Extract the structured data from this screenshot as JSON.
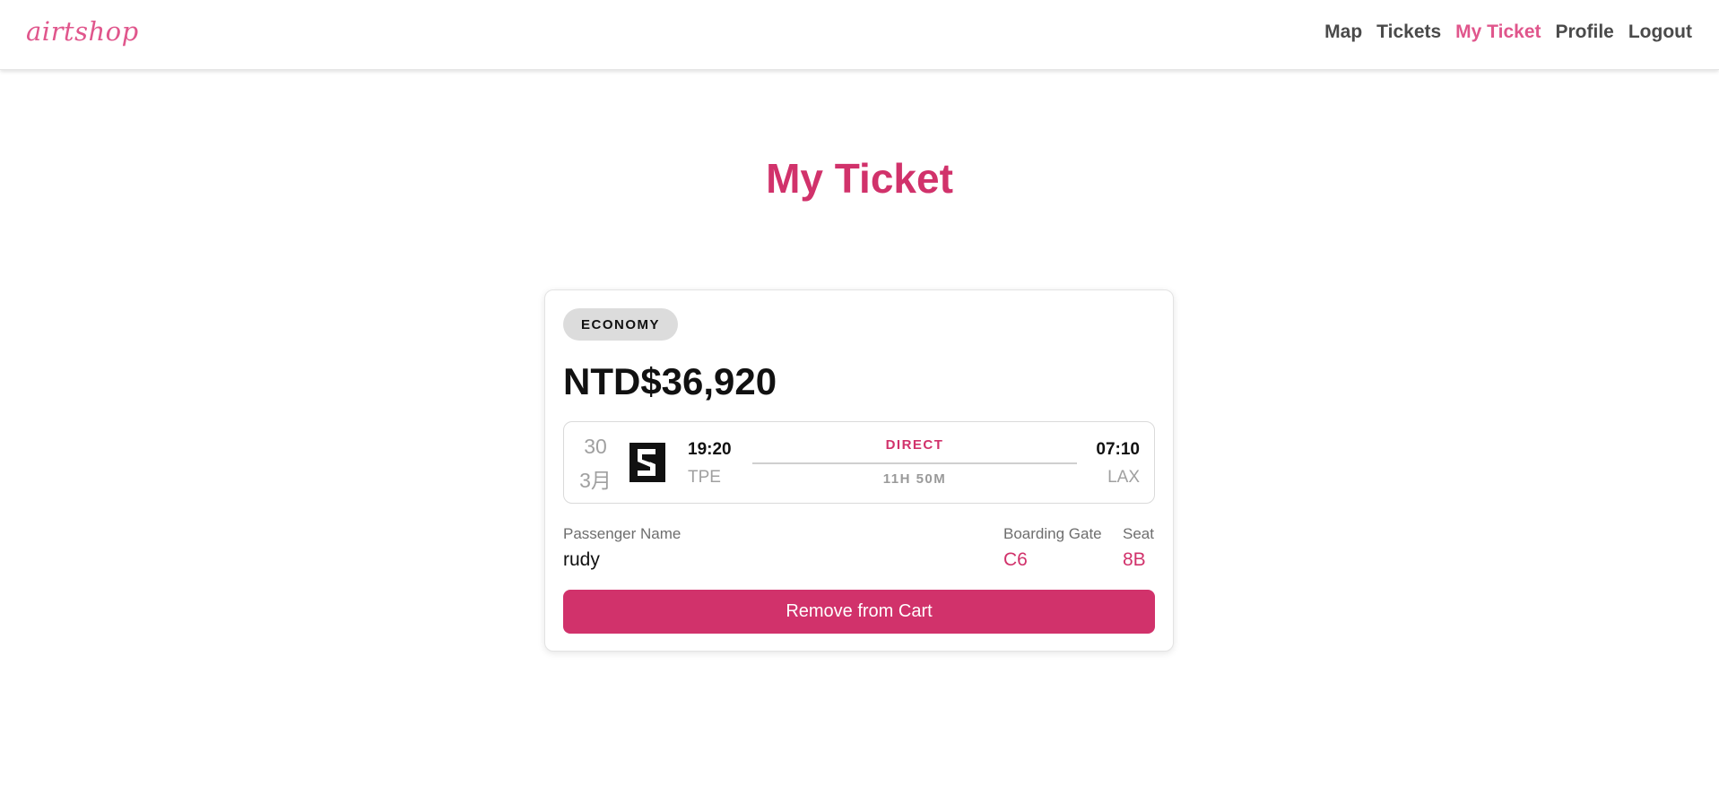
{
  "app": {
    "logo": "airtshop"
  },
  "nav": {
    "items": [
      {
        "label": "Map",
        "active": false
      },
      {
        "label": "Tickets",
        "active": false
      },
      {
        "label": "My Ticket",
        "active": true
      },
      {
        "label": "Profile",
        "active": false
      },
      {
        "label": "Logout",
        "active": false
      }
    ]
  },
  "page": {
    "title": "My Ticket"
  },
  "ticket": {
    "class_badge": "ECONOMY",
    "price": "NTD$36,920",
    "date_day": "30",
    "date_month": "3月",
    "airline_logo_icon": "airline-logo-icon",
    "departure": {
      "time": "19:20",
      "airport": "TPE"
    },
    "arrival": {
      "time": "07:10",
      "airport": "LAX"
    },
    "stop_type": "DIRECT",
    "duration": "11H 50M",
    "passenger_label": "Passenger Name",
    "passenger_name": "rudy",
    "gate_label": "Boarding Gate",
    "gate": "C6",
    "seat_label": "Seat",
    "seat": "8B",
    "remove_label": "Remove from Cart"
  },
  "colors": {
    "brand": "#d1326b",
    "nav_active": "#e0568c",
    "muted": "#a0a0a0",
    "badge_bg": "#dcdcdc"
  }
}
